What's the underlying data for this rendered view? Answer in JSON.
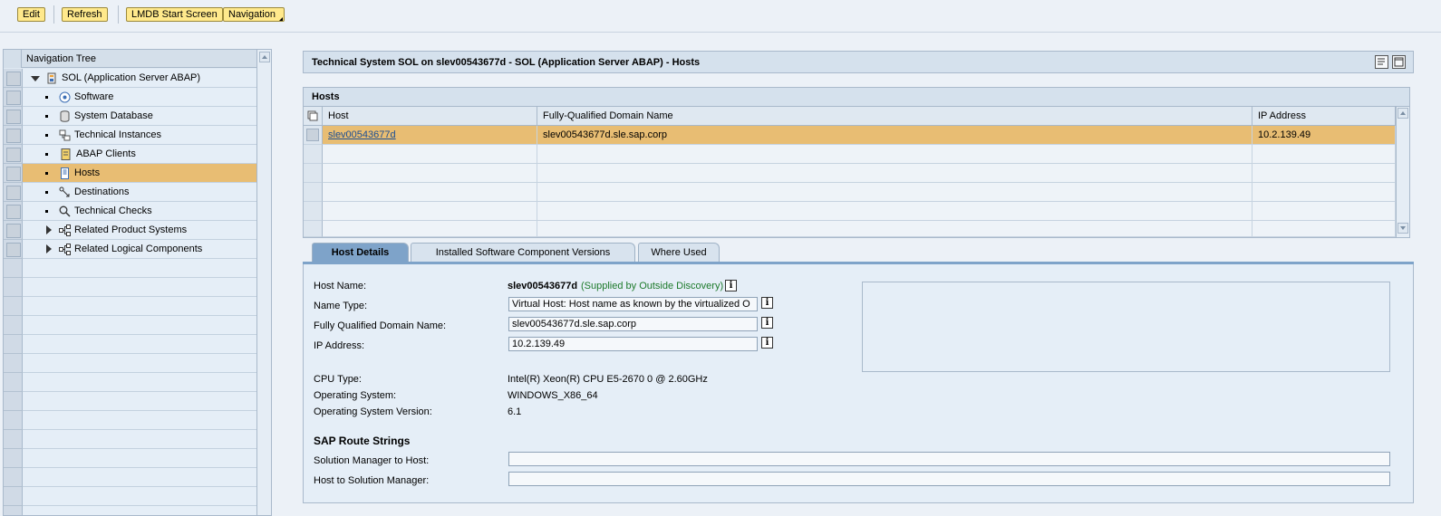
{
  "toolbar": {
    "edit": "Edit",
    "refresh": "Refresh",
    "lmdb_start": "LMDB Start Screen",
    "navigation": "Navigation"
  },
  "tree": {
    "header": "Navigation Tree",
    "root": "SOL (Application Server ABAP)",
    "items": [
      {
        "label": "Software",
        "icon": "software-icon"
      },
      {
        "label": "System Database",
        "icon": "database-icon"
      },
      {
        "label": "Technical Instances",
        "icon": "instances-icon"
      },
      {
        "label": "ABAP Clients",
        "icon": "clients-icon"
      },
      {
        "label": "Hosts",
        "icon": "host-icon",
        "selected": true
      },
      {
        "label": "Destinations",
        "icon": "destinations-icon"
      },
      {
        "label": "Technical Checks",
        "icon": "magnifier-icon"
      },
      {
        "label": "Related Product Systems",
        "icon": "related-icon"
      },
      {
        "label": "Related Logical Components",
        "icon": "related-icon"
      }
    ]
  },
  "panel": {
    "title": "Technical System SOL on slev00543677d - SOL (Application Server ABAP) - Hosts"
  },
  "hosts": {
    "caption": "Hosts",
    "columns": [
      "Host",
      "Fully-Qualified Domain Name",
      "IP Address"
    ],
    "rows": [
      {
        "host": "slev00543677d",
        "fqdn": "slev00543677d.sle.sap.corp",
        "ip": "10.2.139.49"
      }
    ]
  },
  "tabs": [
    "Host Details",
    "Installed Software Component Versions",
    "Where Used"
  ],
  "details": {
    "host_name_label": "Host Name:",
    "host_name": "slev00543677d",
    "host_name_note": "(Supplied by Outside Discovery)",
    "name_type_label": "Name Type:",
    "name_type": "Virtual Host: Host name as known by the virtualized O",
    "fqdn_label": "Fully Qualified Domain Name:",
    "fqdn": "slev00543677d.sle.sap.corp",
    "ip_label": "IP Address:",
    "ip": "10.2.139.49",
    "cpu_label": "CPU Type:",
    "cpu": "Intel(R) Xeon(R) CPU E5-2670 0 @ 2.60GHz",
    "os_label": "Operating System:",
    "os": "WINDOWS_X86_64",
    "osver_label": "Operating System Version:",
    "osver": "6.1",
    "route_heading": "SAP Route Strings",
    "sm_to_host_label": "Solution Manager to Host:",
    "host_to_sm_label": "Host to Solution Manager:",
    "info_glyph": "i"
  }
}
